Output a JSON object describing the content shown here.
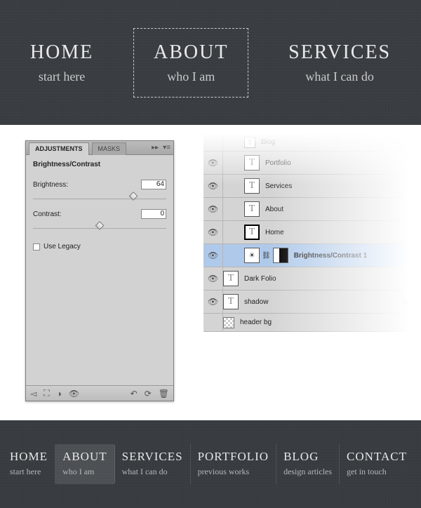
{
  "topnav": [
    {
      "title": "HOME",
      "subtitle": "start here",
      "selected": false
    },
    {
      "title": "ABOUT",
      "subtitle": "who I am",
      "selected": true
    },
    {
      "title": "SERVICES",
      "subtitle": "what I can do",
      "selected": false
    }
  ],
  "adjPanel": {
    "tab1": "ADJUSTMENTS",
    "tab2": "MASKS",
    "heading": "Brightness/Contrast",
    "brightnessLabel": "Brightness:",
    "brightnessValue": "64",
    "contrastLabel": "Contrast:",
    "contrastValue": "0",
    "legacyLabel": "Use Legacy"
  },
  "layers": [
    {
      "eye": false,
      "indent": 1,
      "thumb": "t-sm",
      "name": "Blog",
      "small": true
    },
    {
      "eye": true,
      "indent": 1,
      "thumb": "t",
      "name": "Portfolio"
    },
    {
      "eye": true,
      "indent": 1,
      "thumb": "t",
      "name": "Services"
    },
    {
      "eye": true,
      "indent": 1,
      "thumb": "t",
      "name": "About"
    },
    {
      "eye": true,
      "indent": 1,
      "thumb": "t-sel",
      "name": "Home"
    },
    {
      "eye": true,
      "indent": 1,
      "thumb": "adj",
      "name": "Brightness/Contrast 1",
      "selected": true,
      "bold": true
    },
    {
      "eye": true,
      "indent": 0,
      "thumb": "t",
      "name": "Dark Folio"
    },
    {
      "eye": true,
      "indent": 0,
      "thumb": "t",
      "name": "shadow",
      "fx": "fx"
    },
    {
      "eye": false,
      "indent": 0,
      "thumb": "checker",
      "name": "header bg",
      "small": true
    }
  ],
  "bottomnav": [
    {
      "t": "HOME",
      "s": "start here",
      "active": false
    },
    {
      "t": "ABOUT",
      "s": "who I am",
      "active": true
    },
    {
      "t": "SERVICES",
      "s": "what I can do",
      "active": false
    },
    {
      "t": "PORTFOLIO",
      "s": "previous works",
      "active": false
    },
    {
      "t": "BLOG",
      "s": "design articles",
      "active": false
    },
    {
      "t": "CONTACT",
      "s": "get in touch",
      "active": false
    }
  ]
}
